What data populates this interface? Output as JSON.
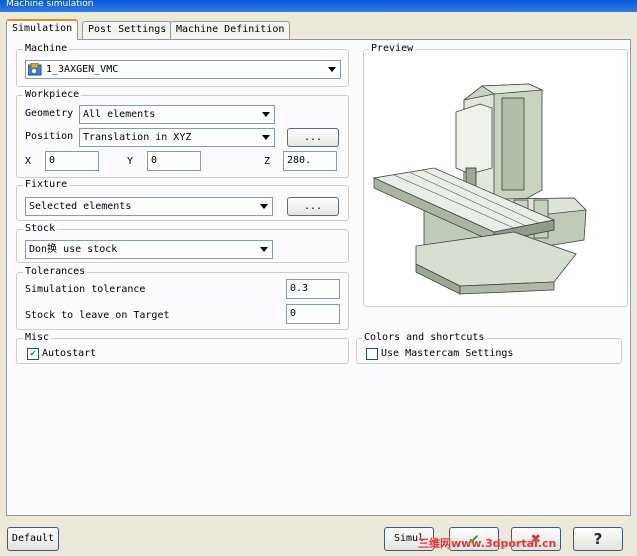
{
  "window": {
    "title": "Machine simulation"
  },
  "tabs": [
    {
      "label": "Simulation"
    },
    {
      "label": "Post Settings"
    },
    {
      "label": "Machine Definition"
    }
  ],
  "machine": {
    "group_label": "Machine",
    "selected": "1_3AXGEN_VMC"
  },
  "workpiece": {
    "group_label": "Workpiece",
    "geometry_label": "Geometry",
    "geometry_value": "All elements",
    "position_label": "Position",
    "position_value": "Translation in XYZ",
    "browse_label": "...",
    "x_label": "X",
    "x_value": "0",
    "y_label": "Y",
    "y_value": "0",
    "z_label": "Z",
    "z_value": "280."
  },
  "fixture": {
    "group_label": "Fixture",
    "value": "Selected elements",
    "browse_label": "..."
  },
  "stock": {
    "group_label": "Stock",
    "value": "Don换 use stock"
  },
  "tolerances": {
    "group_label": "Tolerances",
    "sim_tol_label": "Simulation tolerance",
    "sim_tol_value": "0.3",
    "stock_leave_label": "Stock to leave on Target",
    "stock_leave_value": "0"
  },
  "misc": {
    "group_label": "Misc",
    "autostart_label": "Autostart",
    "autostart_checked": true
  },
  "preview": {
    "group_label": "Preview"
  },
  "colors": {
    "group_label": "Colors and shortcuts",
    "use_mastercam_label": "Use Mastercam Settings",
    "checked": false
  },
  "footer": {
    "default_label": "Default",
    "simulate_label": "Simul",
    "watermark": "三维网www.3dportal.cn"
  },
  "colors_palette": {
    "ok_check": "#21a121",
    "cancel_x": "#d9261c",
    "help": "#2a2a2a",
    "tab_accent": "#e68b2c"
  }
}
